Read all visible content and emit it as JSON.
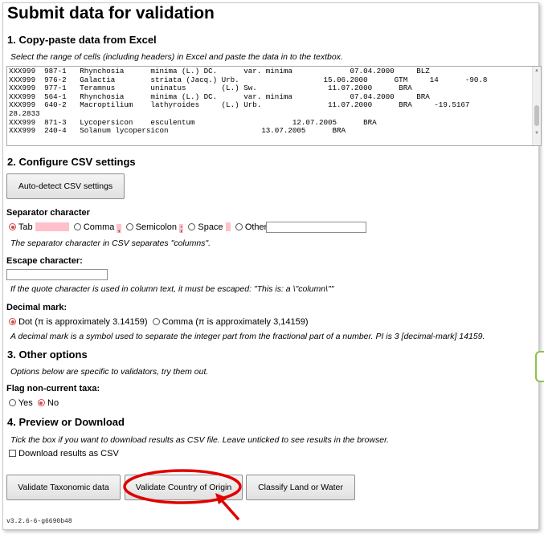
{
  "page": {
    "title": "Submit data for validation",
    "version": "v3.2.6-6-g6690b48"
  },
  "section1": {
    "heading": "1. Copy-paste data from Excel",
    "hint": "Select the range of cells (including headers) in Excel and paste the data in to the textbox.",
    "textarea_lines": [
      "XXX999  987-1   Rhynchosia      minima (L.) DC.      var. minima             07.04.2000     BLZ",
      "XXX999  976-2   Galactia        striata (Jacq.) Urb.                   15.06.2000      GTM     14      -90.8",
      "XXX999  977-1   Teramnus        uninatus        (L.) Sw.                11.07.2000      BRA",
      "XXX999  564-1   Rhynchosia      minima (L.) DC.      var. minima             07.04.2000     BRA",
      "XXX999  640-2   Macroptilium    lathyroides     (L.) Urb.               11.07.2000      BRA     -19.5167",
      "28.2833",
      "XXX999  871-3   Lycopersicon    esculentum                      12.07.2005      BRA",
      "XXX999  240-4   Solanum lycopersicon                     13.07.2005      BRA"
    ]
  },
  "section2": {
    "heading": "2. Configure CSV settings",
    "autodetect_label": "Auto-detect CSV settings",
    "separator_label": "Separator character",
    "sep_tab": "Tab",
    "sep_comma": "Comma",
    "sep_comma_char": ",",
    "sep_semicolon": "Semicolon",
    "sep_semicolon_char": ";",
    "sep_space": "Space",
    "sep_other": "Other",
    "separator_hint": "The separator character in CSV separates \"columns\".",
    "escape_label": "Escape character:",
    "escape_hint": "If the quote character is used in column text, it must be escaped: \"This is: a \\\"column\\\"\"",
    "decimal_label": "Decimal mark:",
    "dec_dot": "Dot (π is approximately 3.14159)",
    "dec_comma": "Comma (π is approximately 3,14159)",
    "decimal_hint": "A decimal mark is a symbol used to separate the integer part from the fractional part of a number. PI is 3 [decimal-mark] 14159.",
    "swatch_color": "#ffc0cb"
  },
  "section3": {
    "heading": "3. Other options",
    "hint": "Options below are specific to validators, try them out.",
    "flag_label": "Flag non-current taxa:",
    "yes": "Yes",
    "no": "No"
  },
  "section4": {
    "heading": "4. Preview or Download",
    "hint": "Tick the box if you want to download results as CSV file. Leave unticked to see results in the browser.",
    "download_label": "Download results as CSV"
  },
  "buttons": {
    "taxonomic": "Validate Taxonomic data",
    "country": "Validate Country of Origin",
    "land_water": "Classify Land or Water"
  },
  "annotation": {
    "color": "#e00000"
  }
}
